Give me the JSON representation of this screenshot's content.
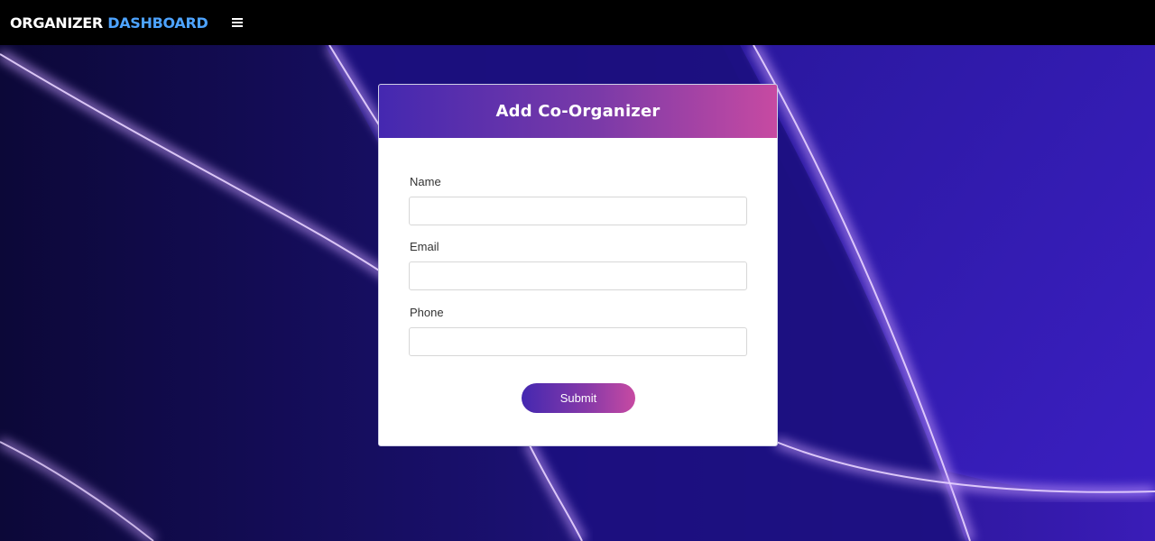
{
  "navbar": {
    "brand_primary": "ORGANIZER",
    "brand_accent": "DASHBOARD",
    "menu_icon": "hamburger-menu-icon",
    "brand_accent_color": "#4da3ff",
    "background_color": "#000000"
  },
  "form_card": {
    "title": "Add Co-Organizer",
    "fields": [
      {
        "label": "Name",
        "value": "",
        "placeholder": ""
      },
      {
        "label": "Email",
        "value": "",
        "placeholder": ""
      },
      {
        "label": "Phone",
        "value": "",
        "placeholder": ""
      }
    ],
    "submit_label": "Submit",
    "gradient_start": "#4428b0",
    "gradient_end": "#c74aa2"
  },
  "background": {
    "base_color": "#2a16a0",
    "glow_color": "#c9a0ff"
  }
}
